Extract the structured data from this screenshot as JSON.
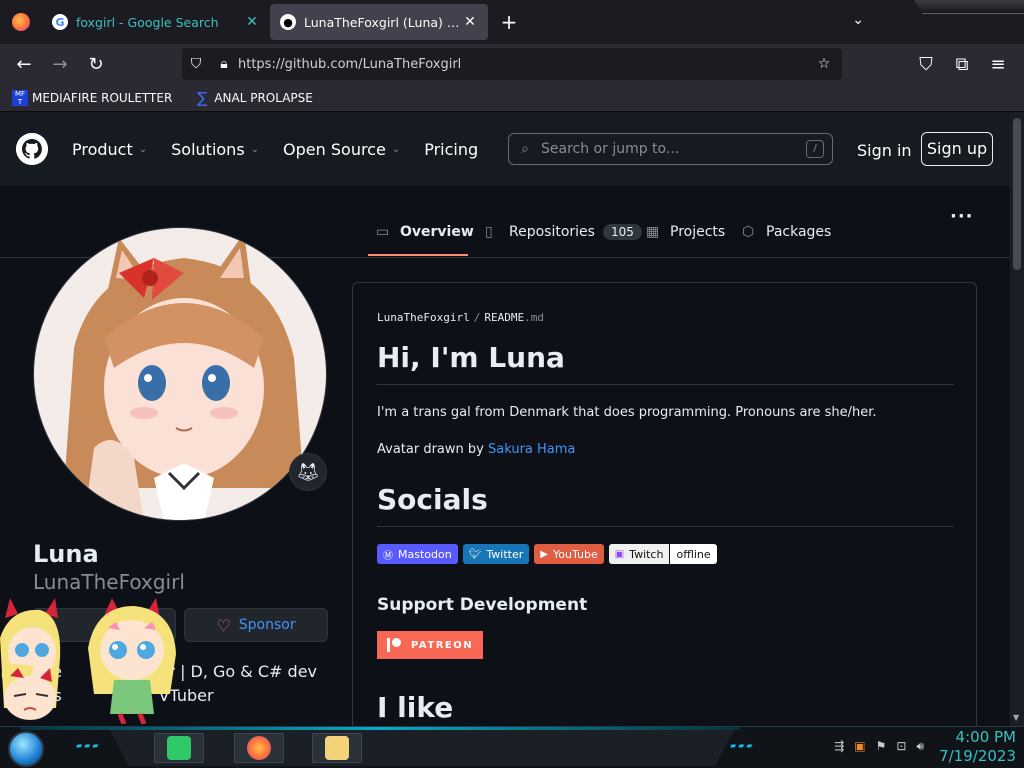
{
  "browser": {
    "tabs": [
      {
        "title": "foxgirl - Google Search",
        "favicon": "google-icon",
        "active": false
      },
      {
        "title": "LunaTheFoxgirl (Luna) · GitHub",
        "favicon": "github-icon",
        "active": true
      }
    ],
    "url": "https://github.com/LunaTheFoxgirl",
    "bookmarks": [
      {
        "label": "MEDIAFIRE ROULETTER",
        "icon": "mediafire-icon"
      },
      {
        "label": "ANAL PROLAPSE",
        "icon": "sigma-icon"
      }
    ]
  },
  "github_header": {
    "menu": [
      "Product",
      "Solutions",
      "Open Source",
      "Pricing"
    ],
    "search_placeholder": "Search or jump to...",
    "search_shortcut": "/",
    "sign_in": "Sign in",
    "sign_up": "Sign up"
  },
  "profile_tabs": [
    {
      "label": "Overview",
      "icon": "book-icon",
      "selected": true
    },
    {
      "label": "Repositories",
      "icon": "repo-icon",
      "count": "105"
    },
    {
      "label": "Projects",
      "icon": "table-icon"
    },
    {
      "label": "Packages",
      "icon": "package-icon"
    }
  ],
  "profile": {
    "name": "Luna",
    "login": "LunaTheFoxgirl",
    "status_emoji": "fox-emoji",
    "sponsor_label": "Sponsor",
    "bio_line1": "| Le                 her | D, Go & C# dev",
    "bio_line2": "  ns                 | VTuber"
  },
  "readme": {
    "owner": "LunaTheFoxgirl",
    "file": "README",
    "ext": ".md",
    "heading": "Hi, I'm Luna",
    "intro": "I'm a trans gal from Denmark that does programming. Pronouns are she/her.",
    "avatar_prefix": "Avatar drawn by ",
    "avatar_artist": "Sakura Hama",
    "socials_heading": "Socials",
    "badges": [
      "Mastodon",
      "Twitter",
      "YouTube",
      "Twitch",
      "offline"
    ],
    "support_heading": "Support Development",
    "patreon_label": "PATREON",
    "like_heading": "I like"
  },
  "taskbar": {
    "time": "4:00 PM",
    "date": "7/19/2023"
  }
}
